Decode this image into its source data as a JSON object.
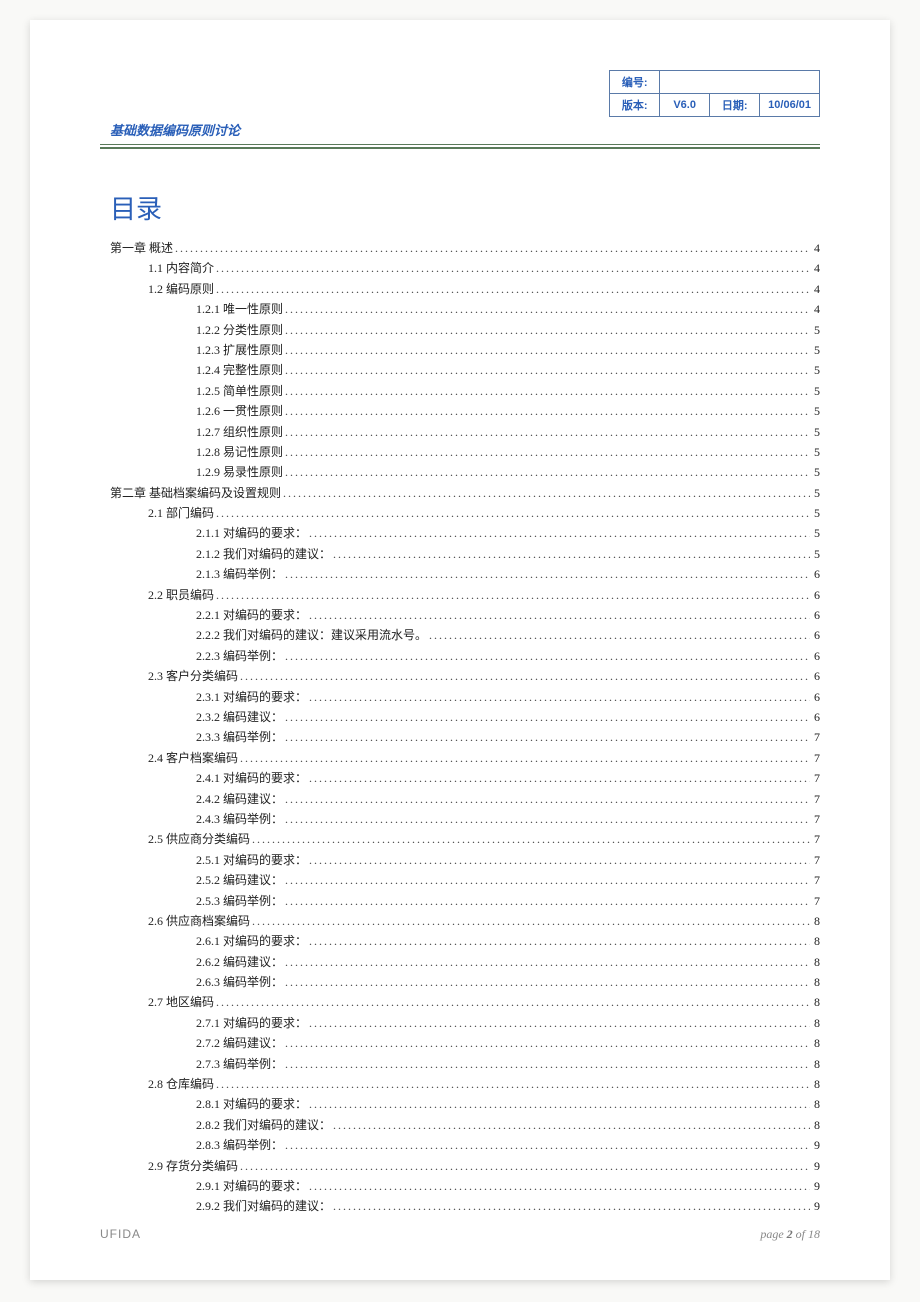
{
  "meta": {
    "numLabel": "编号:",
    "numValue": "",
    "versionLabel": "版本:",
    "versionValue": "V6.0",
    "dateLabel": "日期:",
    "dateValue": "10/06/01"
  },
  "headerTitle": "基础数据编码原则讨论",
  "tocHeading": "目录",
  "toc": [
    {
      "level": 1,
      "label": "第一章 概述",
      "page": "4"
    },
    {
      "level": 2,
      "label": "1.1 内容简介",
      "page": "4"
    },
    {
      "level": 2,
      "label": "1.2 编码原则",
      "page": "4"
    },
    {
      "level": 3,
      "label": "1.2.1 唯一性原则",
      "page": "4"
    },
    {
      "level": 3,
      "label": "1.2.2 分类性原则",
      "page": "5"
    },
    {
      "level": 3,
      "label": "1.2.3 扩展性原则",
      "page": "5"
    },
    {
      "level": 3,
      "label": "1.2.4 完整性原则",
      "page": "5"
    },
    {
      "level": 3,
      "label": "1.2.5 简单性原则",
      "page": "5"
    },
    {
      "level": 3,
      "label": "1.2.6 一贯性原则",
      "page": "5"
    },
    {
      "level": 3,
      "label": "1.2.7 组织性原则",
      "page": "5"
    },
    {
      "level": 3,
      "label": "1.2.8 易记性原则",
      "page": "5"
    },
    {
      "level": 3,
      "label": "1.2.9 易录性原则",
      "page": "5"
    },
    {
      "level": 1,
      "label": "第二章 基础档案编码及设置规则",
      "page": "5"
    },
    {
      "level": 2,
      "label": "2.1 部门编码",
      "page": "5"
    },
    {
      "level": 3,
      "label": "2.1.1 对编码的要求：",
      "page": "5"
    },
    {
      "level": 3,
      "label": "2.1.2 我们对编码的建议：",
      "page": "5"
    },
    {
      "level": 3,
      "label": "2.1.3 编码举例：",
      "page": "6"
    },
    {
      "level": 2,
      "label": "2.2 职员编码",
      "page": "6"
    },
    {
      "level": 3,
      "label": "2.2.1 对编码的要求：",
      "page": "6"
    },
    {
      "level": 3,
      "label": "2.2.2 我们对编码的建议：建议采用流水号。",
      "page": "6"
    },
    {
      "level": 3,
      "label": "2.2.3 编码举例：",
      "page": "6"
    },
    {
      "level": 2,
      "label": "2.3 客户分类编码",
      "page": "6"
    },
    {
      "level": 3,
      "label": "2.3.1 对编码的要求：",
      "page": "6"
    },
    {
      "level": 3,
      "label": "2.3.2 编码建议：",
      "page": "6"
    },
    {
      "level": 3,
      "label": "2.3.3 编码举例：",
      "page": "7"
    },
    {
      "level": 2,
      "label": "2.4 客户档案编码",
      "page": "7"
    },
    {
      "level": 3,
      "label": "2.4.1 对编码的要求：",
      "page": "7"
    },
    {
      "level": 3,
      "label": "2.4.2 编码建议：",
      "page": "7"
    },
    {
      "level": 3,
      "label": "2.4.3 编码举例：",
      "page": "7"
    },
    {
      "level": 2,
      "label": "2.5 供应商分类编码",
      "page": "7"
    },
    {
      "level": 3,
      "label": "2.5.1 对编码的要求：",
      "page": "7"
    },
    {
      "level": 3,
      "label": "2.5.2 编码建议：",
      "page": "7"
    },
    {
      "level": 3,
      "label": "2.5.3 编码举例：",
      "page": "7"
    },
    {
      "level": 2,
      "label": "2.6 供应商档案编码",
      "page": "8"
    },
    {
      "level": 3,
      "label": "2.6.1 对编码的要求：",
      "page": "8"
    },
    {
      "level": 3,
      "label": "2.6.2 编码建议：",
      "page": "8"
    },
    {
      "level": 3,
      "label": "2.6.3 编码举例：",
      "page": "8"
    },
    {
      "level": 2,
      "label": "2.7 地区编码",
      "page": "8"
    },
    {
      "level": 3,
      "label": "2.7.1 对编码的要求：",
      "page": "8"
    },
    {
      "level": 3,
      "label": "2.7.2 编码建议：",
      "page": "8"
    },
    {
      "level": 3,
      "label": "2.7.3 编码举例：",
      "page": "8"
    },
    {
      "level": 2,
      "label": "2.8 仓库编码",
      "page": "8"
    },
    {
      "level": 3,
      "label": "2.8.1 对编码的要求：",
      "page": "8"
    },
    {
      "level": 3,
      "label": "2.8.2 我们对编码的建议：",
      "page": "8"
    },
    {
      "level": 3,
      "label": "2.8.3 编码举例：",
      "page": "9"
    },
    {
      "level": 2,
      "label": "2.9 存货分类编码",
      "page": "9"
    },
    {
      "level": 3,
      "label": "2.9.1 对编码的要求：",
      "page": "9"
    },
    {
      "level": 3,
      "label": "2.9.2 我们对编码的建议：",
      "page": "9"
    }
  ],
  "footer": {
    "brand": "UFIDA",
    "pagePrefix": "page ",
    "pageCurrent": "2",
    "pageOf": " of ",
    "pageTotal": "18"
  }
}
